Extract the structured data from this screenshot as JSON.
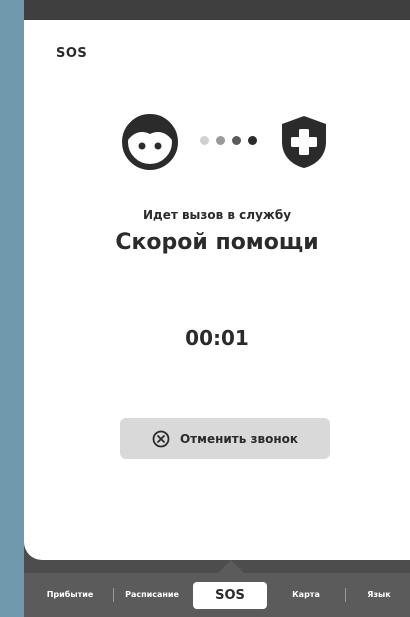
{
  "screen": {
    "title": "SOS",
    "status_text": "Идет вызов в службу",
    "service_name": "Скорой помощи",
    "timer": "00:01",
    "cancel_button": {
      "label": "Отменить звонок",
      "icon": "cancel-circle-icon"
    }
  },
  "call_graphic": {
    "caller_icon": "person-face-icon",
    "service_icon": "medical-shield-icon",
    "dots": [
      "#d0d0d0",
      "#9a9a9a",
      "#5a5a5a",
      "#2b2b2b"
    ]
  },
  "bottom_nav": {
    "items": [
      {
        "label": "Прибытие",
        "active": false
      },
      {
        "label": "Расписание",
        "active": false
      },
      {
        "label": "SOS",
        "active": true
      },
      {
        "label": "Карта",
        "active": false
      },
      {
        "label": "Язык",
        "active": false
      }
    ]
  },
  "colors": {
    "card_background": "#ffffff",
    "side_accent": "#6f99ad",
    "nav_background": "#5b5b5b",
    "text_dark": "#2b2b2b",
    "button_background": "#d9d9d9"
  }
}
